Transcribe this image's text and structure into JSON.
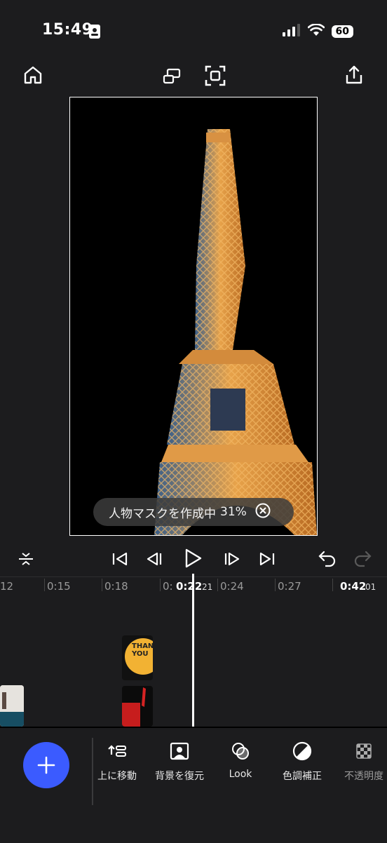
{
  "status": {
    "time": "15:49",
    "battery": "60"
  },
  "preview": {
    "mask_status": "人物マスクを作成中",
    "mask_percent": "31%"
  },
  "ruler": {
    "ticks": [
      "12",
      "0:15",
      "0:18",
      "0:",
      "0:24",
      "0:27"
    ],
    "current_time": "0:22",
    "current_frame": "21",
    "total_time": "0:42",
    "total_frame": "01"
  },
  "clips": {
    "thank_you_text": "THANK YOU"
  },
  "toolbar": {
    "items": [
      {
        "label": "上に移動",
        "icon": "move-up-icon"
      },
      {
        "label": "背景を復元",
        "icon": "restore-background-icon"
      },
      {
        "label": "Look",
        "icon": "look-icon"
      },
      {
        "label": "色調補正",
        "icon": "color-adjust-icon"
      },
      {
        "label": "不透明度",
        "icon": "opacity-icon"
      }
    ]
  },
  "colors": {
    "accent": "#3b5bff",
    "background": "#1c1c1e"
  }
}
